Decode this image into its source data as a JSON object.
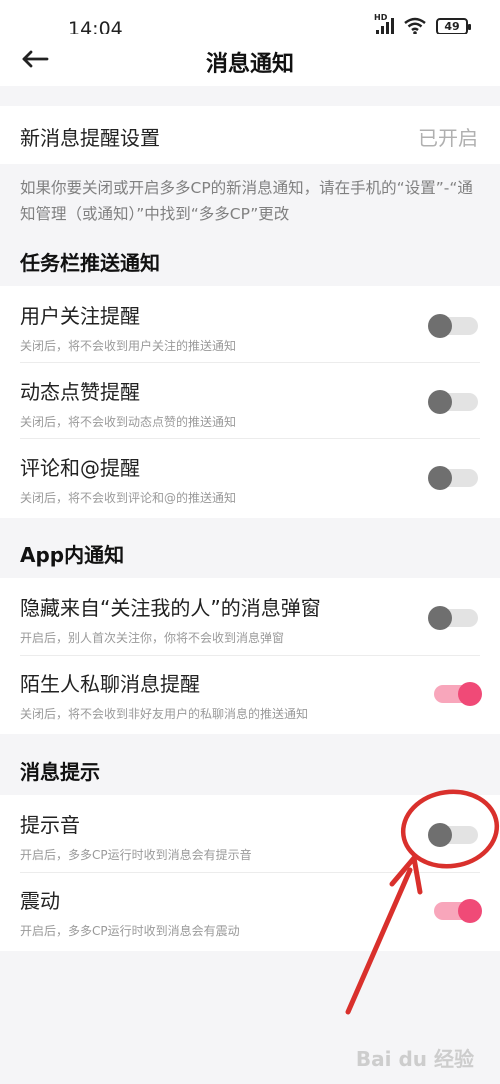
{
  "status_bar": {
    "time": "14:04",
    "battery": "49",
    "network": "HD"
  },
  "nav": {
    "title": "消息通知"
  },
  "new_msg": {
    "label": "新消息提醒设置",
    "value": "已开启"
  },
  "hint": "如果你要关闭或开启多多CP的新消息通知，请在手机的“设置”-“通知管理（或通知）”中找到“多多CP”更改",
  "sections": {
    "taskbar": "任务栏推送通知",
    "inapp": "App内通知",
    "tips": "消息提示"
  },
  "items": {
    "follow": {
      "label": "用户关注提醒",
      "desc": "关闭后，将不会收到用户关注的推送通知",
      "on": false
    },
    "like": {
      "label": "动态点赞提醒",
      "desc": "关闭后，将不会收到动态点赞的推送通知",
      "on": false
    },
    "comment": {
      "label": "评论和@提醒",
      "desc": "关闭后，将不会收到评论和@的推送通知",
      "on": false
    },
    "hide_popup": {
      "label": "隐藏来自“关注我的人”的消息弹窗",
      "desc": "开启后，别人首次关注你，你将不会收到消息弹窗",
      "on": false
    },
    "stranger": {
      "label": "陌生人私聊消息提醒",
      "desc": "关闭后，将不会收到非好友用户的私聊消息的推送通知",
      "on": true
    },
    "sound": {
      "label": "提示音",
      "desc": "开启后，多多CP运行时收到消息会有提示音",
      "on": false
    },
    "vibrate": {
      "label": "震动",
      "desc": "开启后，多多CP运行时收到消息会有震动",
      "on": true
    }
  },
  "colors": {
    "accent": "#f04a77",
    "annotation": "#d9302c"
  },
  "watermark": "Bai du 经验"
}
